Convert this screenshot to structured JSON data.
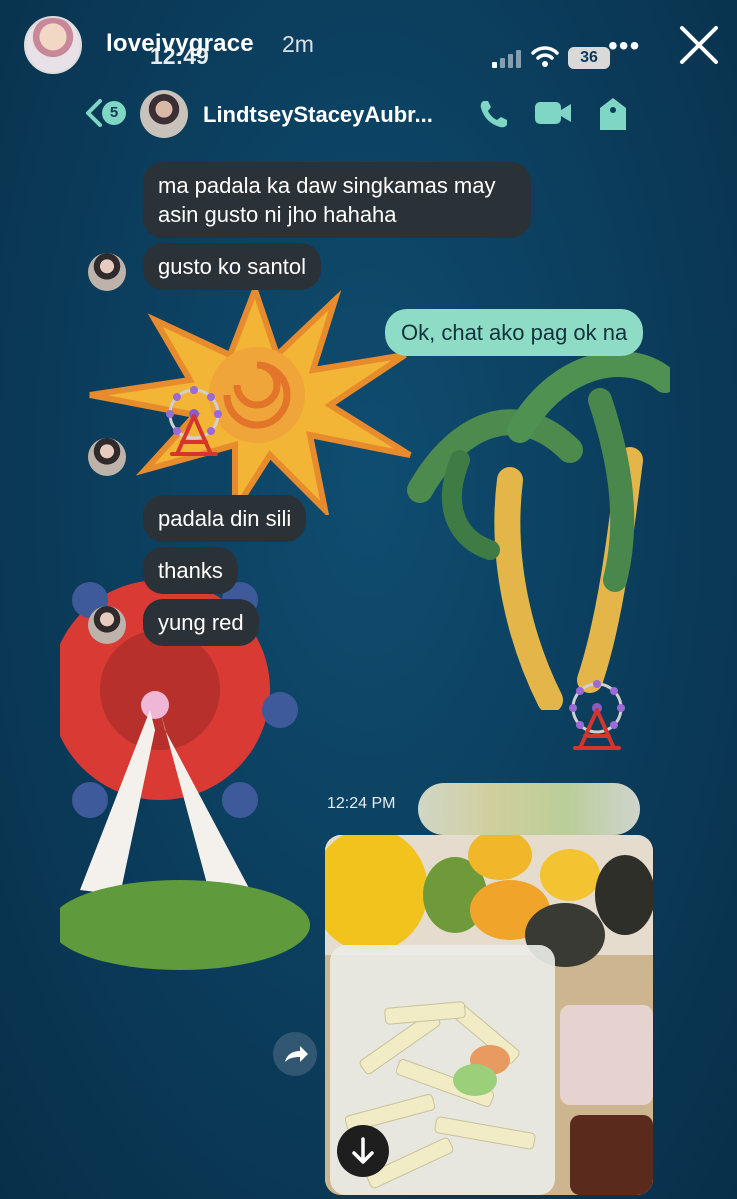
{
  "story": {
    "username": "loveivygrace",
    "time_ago": "2m",
    "more_label": "•••"
  },
  "status_bar": {
    "time": "12:49",
    "battery": "36"
  },
  "chat": {
    "unread_count": "5",
    "title": "LindtseyStaceyAubr..."
  },
  "messages": [
    {
      "text_line1": "ma padala ka daw singkamas may",
      "text_line2": "asin gusto ni jho hahaha"
    },
    {
      "text": "gusto ko santol"
    },
    {
      "text": "Ok, chat ako pag ok na"
    },
    {
      "text": "padala din sili"
    },
    {
      "text": "thanks"
    },
    {
      "text": "yung red"
    }
  ],
  "timestamp": "12:24 PM",
  "icons": {
    "close": "close-icon",
    "back": "chevron-left-icon",
    "call": "phone-icon",
    "video": "video-camera-icon",
    "tag": "tag-icon",
    "share": "share-arrow-icon",
    "download": "download-arrow-icon",
    "sticker": "ferris-wheel-icon"
  },
  "colors": {
    "background": "#0b3b5a",
    "incoming_bubble": "#2b3237",
    "outgoing_bubble": "#8fdcc6",
    "accent": "#7fd6c4"
  }
}
